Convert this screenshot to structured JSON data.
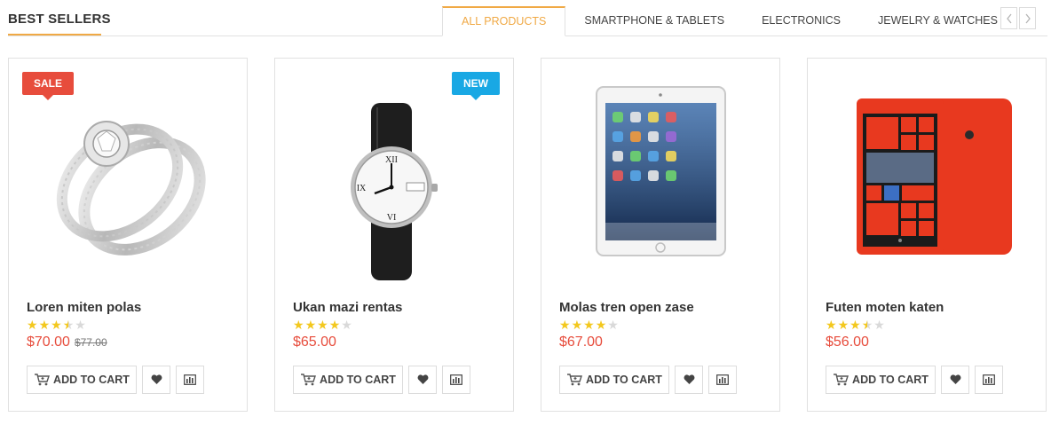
{
  "section": {
    "title": "BEST SELLERS"
  },
  "tabs": [
    {
      "label": "ALL PRODUCTS",
      "active": true
    },
    {
      "label": "SMARTPHONE & TABLETS",
      "active": false
    },
    {
      "label": "ELECTRONICS",
      "active": false
    },
    {
      "label": "JEWELRY & WATCHES",
      "active": false
    }
  ],
  "pager": {
    "prev_icon": "chevron-left-icon",
    "next_icon": "chevron-right-icon"
  },
  "products": [
    {
      "name": "Loren miten polas",
      "rating": 3.5,
      "price": "$70.00",
      "old_price": "$77.00",
      "badge": "SALE",
      "image": "ring-image",
      "cart_label": "ADD TO CART"
    },
    {
      "name": "Ukan mazi rentas",
      "rating": 4,
      "price": "$65.00",
      "old_price": "",
      "badge": "NEW",
      "image": "watch-image",
      "cart_label": "ADD TO CART"
    },
    {
      "name": "Molas tren open zase",
      "rating": 4,
      "price": "$67.00",
      "old_price": "",
      "badge": "",
      "image": "tablet-image",
      "cart_label": "ADD TO CART"
    },
    {
      "name": "Futen moten katen",
      "rating": 3.5,
      "price": "$56.00",
      "old_price": "",
      "badge": "",
      "image": "smartphone-image",
      "cart_label": "ADD TO CART"
    }
  ],
  "colors": {
    "accent": "#f0a945",
    "price": "#e74c3c",
    "sale_badge": "#e74c3c",
    "new_badge": "#19a8e4",
    "star": "#f3c81e"
  }
}
